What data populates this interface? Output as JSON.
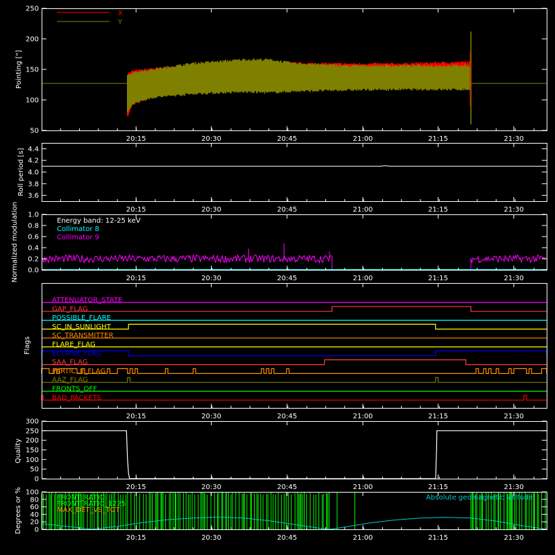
{
  "time_ticks": [
    "20:15",
    "20:30",
    "20:45",
    "21:00",
    "21:15",
    "21:30"
  ],
  "colors": {
    "background": "#000000",
    "axes": "#ffffff",
    "x": "#ff0000",
    "y": "#808000",
    "coll8": "#00ffff",
    "coll9": "#ff00ff",
    "ratio_green": "#00ff00",
    "geomag": "#00cccc"
  },
  "chart_data": [
    {
      "id": "pointing",
      "type": "line",
      "ylabel": "Pointing [\"]",
      "ylim": [
        50,
        250
      ],
      "yticks": [
        50,
        100,
        150,
        200,
        250
      ],
      "xlim_minutes": [
        0,
        100
      ],
      "legend_position": "top-left",
      "series": [
        {
          "name": "X",
          "color": "#ff0000",
          "envelope_x": [
            17,
            18,
            22,
            30,
            40,
            50,
            60,
            70,
            80,
            85
          ],
          "envelope_upper": [
            143,
            147,
            151,
            156,
            160,
            160,
            159,
            159,
            161,
            162
          ],
          "envelope_lower": [
            72,
            93,
            106,
            114,
            118,
            120,
            120,
            120,
            120,
            120
          ]
        },
        {
          "name": "Y",
          "color": "#808000",
          "envelope_x": [
            17,
            18,
            22,
            30,
            40,
            45,
            50,
            60,
            70,
            80,
            85
          ],
          "envelope_upper": [
            140,
            145,
            150,
            160,
            166,
            166,
            160,
            156,
            156,
            156,
            156
          ],
          "envelope_lower": [
            78,
            94,
            104,
            110,
            113,
            112,
            114,
            116,
            117,
            117,
            117
          ]
        }
      ],
      "reference_line": 127,
      "end_spike": [
        60,
        212
      ]
    },
    {
      "id": "roll_period",
      "type": "line",
      "ylabel": "Roll period [s]",
      "ylim": [
        3.5,
        4.5
      ],
      "yticks": [
        3.6,
        3.8,
        4.0,
        4.2,
        4.4
      ],
      "series": [
        {
          "x": [
            0,
            67,
            68,
            69,
            100
          ],
          "y": [
            4.1,
            4.1,
            4.11,
            4.1,
            4.1
          ]
        }
      ]
    },
    {
      "id": "modulation",
      "type": "line",
      "ylabel": "Normalized modulation",
      "ylim": [
        0,
        1.0
      ],
      "yticks": [
        0.0,
        0.2,
        0.4,
        0.6,
        0.8,
        1.0
      ],
      "annotation": "Energy band: 12-25 keV",
      "series": [
        {
          "name": "Collimator 8",
          "color": "#00ffff",
          "x": [
            0,
            100
          ],
          "y": [
            0,
            0
          ]
        },
        {
          "name": "Collimator 9",
          "color": "#ff00ff",
          "segments": [
            [
              0,
              57.5
            ],
            [
              85,
              100
            ]
          ],
          "mean": 0.2,
          "noise": 0.1,
          "spikes": [
            [
              48,
              0.48
            ],
            [
              41,
              0.38
            ],
            [
              57,
              0.33
            ]
          ]
        }
      ]
    },
    {
      "id": "flags",
      "type": "line",
      "ylabel": "Flags",
      "flags": [
        {
          "name": "ATTENUATOR_STATE",
          "color": "#ff00ff",
          "highs": []
        },
        {
          "name": "GAP_FLAG",
          "color": "#ff3b3b",
          "highs": [
            [
              57.5,
              85
            ]
          ]
        },
        {
          "name": "POSSIBLE_FLARE",
          "color": "#00ffff",
          "highs": []
        },
        {
          "name": "SC_IN_SUNLIGHT",
          "color": "#ffff00",
          "highs": [
            [
              17.2,
              78
            ]
          ]
        },
        {
          "name": "SC_TRANSMITTER",
          "color": "#ff8c00",
          "highs": []
        },
        {
          "name": "FLARE_FLAG",
          "color": "#ffff00",
          "highs": []
        },
        {
          "name": "ECLIPSE_FLAG",
          "color": "#0000ff",
          "highs": [
            [
              0,
              17.2
            ],
            [
              78,
              100
            ]
          ]
        },
        {
          "name": "SAA_FLAG",
          "color": "#ff3b3b",
          "highs": [
            [
              56,
              84
            ]
          ]
        },
        {
          "name": "PARTICLE_FLAG",
          "color": "#ff8c00",
          "highs": [
            [
              0,
              1.5
            ],
            [
              2.5,
              3
            ],
            [
              3.5,
              7
            ],
            [
              8,
              8.5
            ],
            [
              13,
              13.5
            ],
            [
              15,
              17
            ],
            [
              17.5,
              18
            ],
            [
              18.5,
              19
            ],
            [
              24.5,
              25
            ],
            [
              30,
              30.5
            ],
            [
              43.5,
              44
            ],
            [
              44.5,
              45
            ],
            [
              45.5,
              46
            ],
            [
              48.5,
              49
            ],
            [
              86,
              86.5
            ],
            [
              87.5,
              88
            ],
            [
              88.5,
              89
            ],
            [
              90,
              90.5
            ],
            [
              92.5,
              93
            ],
            [
              93.5,
              96
            ],
            [
              96.5,
              97
            ],
            [
              99,
              100
            ]
          ]
        },
        {
          "name": "AAZ_FLAG",
          "color": "#808000",
          "highs": [
            [
              17,
              17.5
            ],
            [
              78,
              78.5
            ]
          ]
        },
        {
          "name": "FRONTS_OFF",
          "color": "#00ff00",
          "highs": []
        },
        {
          "name": "BAD_PACKETS",
          "color": "#ff0000",
          "highs": [
            [
              0,
              0.3
            ],
            [
              95.5,
              96
            ]
          ]
        }
      ]
    },
    {
      "id": "quality",
      "type": "line",
      "ylabel": "Quality",
      "ylim": [
        0,
        300
      ],
      "yticks": [
        0,
        50,
        100,
        150,
        200,
        250,
        300
      ],
      "series": [
        {
          "x": [
            0,
            16.8,
            17,
            17.2,
            17.4,
            78,
            78.05,
            78.1,
            78.2,
            78.25,
            78.4,
            100
          ],
          "y": [
            250,
            250,
            100,
            30,
            0,
            0,
            20,
            80,
            150,
            250,
            250,
            250
          ]
        }
      ]
    },
    {
      "id": "geomag",
      "type": "line",
      "ylabel": "Degrees or %",
      "ylim": [
        0,
        100
      ],
      "yticks": [
        0,
        20,
        40,
        60,
        80,
        100
      ],
      "legend_left": [
        "FRONT_RATIO",
        "FRONT_RATIO_1225",
        "MAX_DET_VS_TOT"
      ],
      "legend_right": "Absolute geomagnetic latitude",
      "series": [
        {
          "name": "Absolute geomagnetic latitude",
          "color": "#00cccc",
          "x": [
            0,
            5,
            10,
            15,
            20,
            25,
            30,
            35,
            40,
            45,
            50,
            55,
            57,
            60,
            65,
            70,
            75,
            80,
            85,
            90,
            95,
            100
          ],
          "y": [
            15,
            8,
            0,
            8,
            18,
            26,
            30,
            33,
            30,
            23,
            13,
            3,
            0,
            6,
            17,
            25,
            30,
            32,
            30,
            22,
            10,
            0
          ]
        },
        {
          "name": "FRONT_RATIO",
          "color": "#00ff00",
          "dense_ranges": [
            [
              0,
              57.5
            ],
            [
              85,
              100
            ]
          ]
        }
      ]
    }
  ]
}
